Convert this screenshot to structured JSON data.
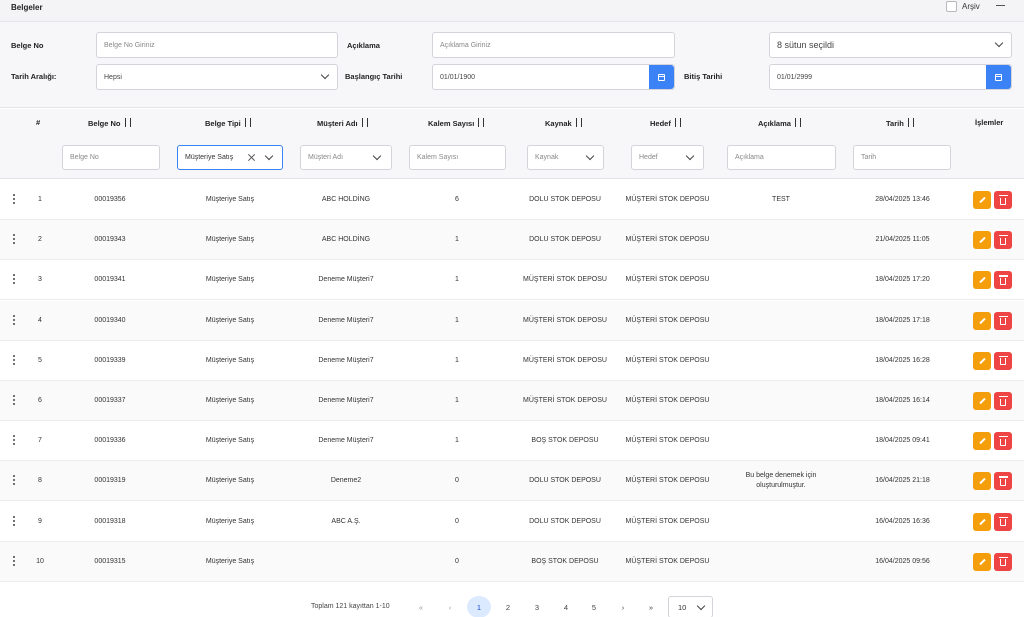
{
  "topbar": {
    "title": "Belgeler",
    "archive_label": "Arşiv"
  },
  "filters": {
    "belge_no": {
      "label": "Belge No",
      "placeholder": "Belge No Giriniz"
    },
    "aciklama": {
      "label": "Açıklama",
      "placeholder": "Açıklama Giriniz"
    },
    "columns": {
      "value": "8 sütun seçildi"
    },
    "tarih_araligi": {
      "label": "Tarih Aralığı:",
      "value": "Hepsi"
    },
    "baslangic": {
      "label": "Başlangıç Tarihi",
      "value": "01/01/1900"
    },
    "bitis": {
      "label": "Bitiş Tarihi",
      "value": "01/01/2999"
    }
  },
  "table": {
    "headers": [
      "#",
      "Belge No",
      "Belge Tipi",
      "Müşteri Adı",
      "Kalem Sayısı",
      "Kaynak",
      "Hedef",
      "Açıklama",
      "Tarih",
      "İşlemler"
    ],
    "column_filters": {
      "belge_no": "Belge No",
      "belge_tipi": "Müşteriye Satış",
      "musteri": "Müşteri Adı",
      "kalem": "Kalem Sayısı",
      "kaynak": "Kaynak",
      "hedef": "Hedef",
      "aciklama": "Açıklama",
      "tarih": "Tarih"
    },
    "rows": [
      {
        "n": "1",
        "no": "00019356",
        "tip": "Müşteriye Satış",
        "musteri": "ABC HOLDİNG",
        "kalem": "6",
        "kaynak": "DOLU STOK DEPOSU",
        "hedef": "MÜŞTERİ STOK DEPOSU",
        "aciklama": "TEST",
        "tarih": "28/04/2025 13:46"
      },
      {
        "n": "2",
        "no": "00019343",
        "tip": "Müşteriye Satış",
        "musteri": "ABC HOLDİNG",
        "kalem": "1",
        "kaynak": "DOLU STOK DEPOSU",
        "hedef": "MÜŞTERİ STOK DEPOSU",
        "aciklama": "",
        "tarih": "21/04/2025 11:05"
      },
      {
        "n": "3",
        "no": "00019341",
        "tip": "Müşteriye Satış",
        "musteri": "Deneme Müşteri7",
        "kalem": "1",
        "kaynak": "MÜŞTERİ STOK DEPOSU",
        "hedef": "MÜŞTERİ STOK DEPOSU",
        "aciklama": "",
        "tarih": "18/04/2025 17:20"
      },
      {
        "n": "4",
        "no": "00019340",
        "tip": "Müşteriye Satış",
        "musteri": "Deneme Müşteri7",
        "kalem": "1",
        "kaynak": "MÜŞTERİ STOK DEPOSU",
        "hedef": "MÜŞTERİ STOK DEPOSU",
        "aciklama": "",
        "tarih": "18/04/2025 17:18"
      },
      {
        "n": "5",
        "no": "00019339",
        "tip": "Müşteriye Satış",
        "musteri": "Deneme Müşteri7",
        "kalem": "1",
        "kaynak": "MÜŞTERİ STOK DEPOSU",
        "hedef": "MÜŞTERİ STOK DEPOSU",
        "aciklama": "",
        "tarih": "18/04/2025 16:28"
      },
      {
        "n": "6",
        "no": "00019337",
        "tip": "Müşteriye Satış",
        "musteri": "Deneme Müşteri7",
        "kalem": "1",
        "kaynak": "MÜŞTERİ STOK DEPOSU",
        "hedef": "MÜŞTERİ STOK DEPOSU",
        "aciklama": "",
        "tarih": "18/04/2025 16:14"
      },
      {
        "n": "7",
        "no": "00019336",
        "tip": "Müşteriye Satış",
        "musteri": "Deneme Müşteri7",
        "kalem": "1",
        "kaynak": "BOŞ STOK DEPOSU",
        "hedef": "MÜŞTERİ STOK DEPOSU",
        "aciklama": "",
        "tarih": "18/04/2025 09:41"
      },
      {
        "n": "8",
        "no": "00019319",
        "tip": "Müşteriye Satış",
        "musteri": "Deneme2",
        "kalem": "0",
        "kaynak": "DOLU STOK DEPOSU",
        "hedef": "MÜŞTERİ STOK DEPOSU",
        "aciklama": "Bu belge denemek için oluşturulmuştur.",
        "tarih": "16/04/2025 21:18"
      },
      {
        "n": "9",
        "no": "00019318",
        "tip": "Müşteriye Satış",
        "musteri": "ABC A.Ş.",
        "kalem": "0",
        "kaynak": "DOLU STOK DEPOSU",
        "hedef": "MÜŞTERİ STOK DEPOSU",
        "aciklama": "",
        "tarih": "16/04/2025 16:36"
      },
      {
        "n": "10",
        "no": "00019315",
        "tip": "Müşteriye Satış",
        "musteri": "",
        "kalem": "0",
        "kaynak": "BOŞ STOK DEPOSU",
        "hedef": "MÜŞTERİ STOK DEPOSU",
        "aciklama": "",
        "tarih": "16/04/2025 09:56"
      }
    ]
  },
  "pagination": {
    "total_text": "Toplam 121 kayıttan 1-10",
    "first": "«",
    "prev": "‹",
    "pages": [
      "1",
      "2",
      "3",
      "4",
      "5"
    ],
    "next": "›",
    "last": "»",
    "page_size": "10"
  },
  "colors": {
    "accent": "#3b82f6",
    "edit": "#f59e0b",
    "delete": "#ef4444"
  }
}
